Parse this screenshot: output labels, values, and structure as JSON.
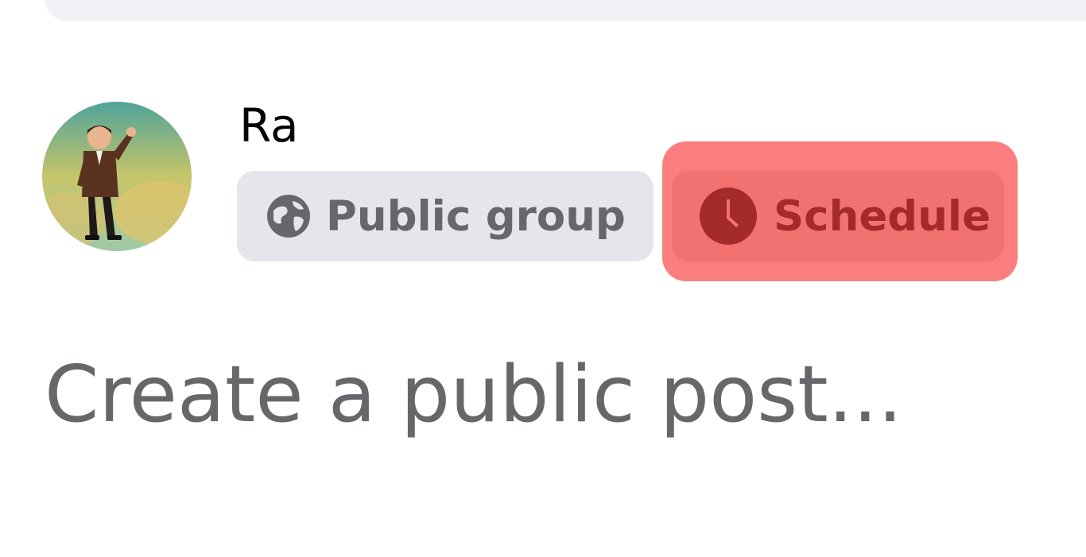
{
  "user": {
    "name": "Ra"
  },
  "audience": {
    "label": "Public group",
    "icon": "globe-icon"
  },
  "schedule": {
    "label": "Schedule",
    "icon": "clock-icon"
  },
  "composer": {
    "placeholder": "Create a public post..."
  },
  "colors": {
    "highlight": "#fb7e7e",
    "schedule_text": "#a52a2a",
    "chip_bg": "#e4e6eb",
    "muted_text": "#65676b"
  }
}
